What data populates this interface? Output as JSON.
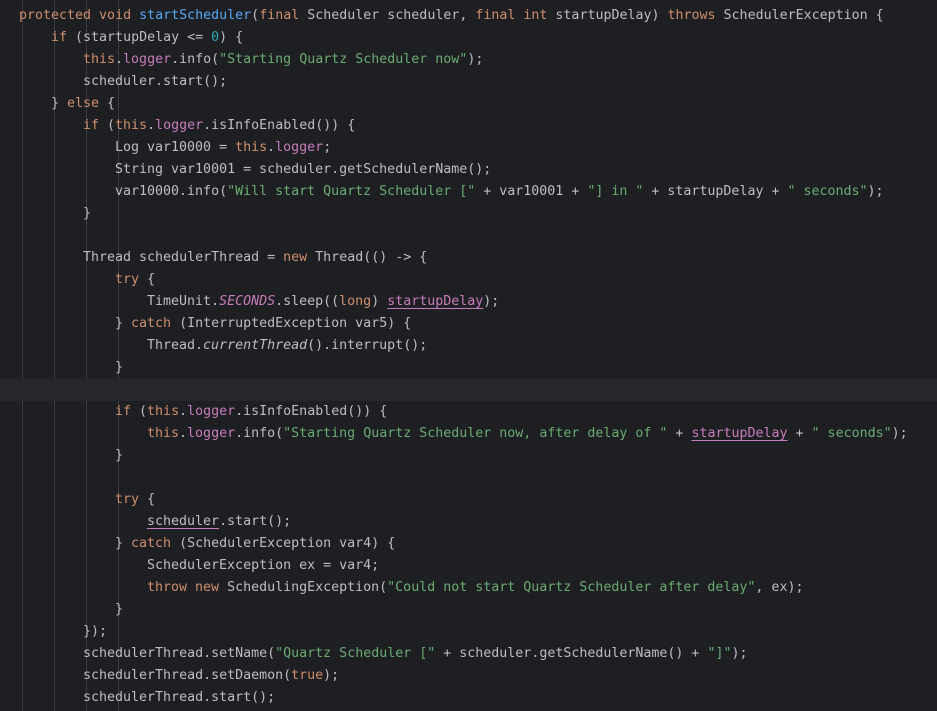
{
  "editor": {
    "language": "java",
    "colors": {
      "background": "#1e1f22",
      "current_line": "#26282e",
      "indent_guide": "#393b40",
      "keyword": "#cf8e6d",
      "function": "#56a8f5",
      "string": "#6aab73",
      "number": "#2aacb8",
      "field": "#c77dbb",
      "plain": "#bcbec4"
    },
    "lines": [
      {
        "indent": 0,
        "tokens": [
          {
            "t": "protected void ",
            "c": "kw"
          },
          {
            "t": "startScheduler",
            "c": "fn"
          },
          {
            "t": "(",
            "c": "pl"
          },
          {
            "t": "final ",
            "c": "kw"
          },
          {
            "t": "Scheduler scheduler, ",
            "c": "pl"
          },
          {
            "t": "final int ",
            "c": "kw"
          },
          {
            "t": "startupDelay) ",
            "c": "pl"
          },
          {
            "t": "throws ",
            "c": "kw"
          },
          {
            "t": "SchedulerException {",
            "c": "pl"
          }
        ]
      },
      {
        "indent": 1,
        "tokens": [
          {
            "t": "if ",
            "c": "kw"
          },
          {
            "t": "(startupDelay <= ",
            "c": "pl"
          },
          {
            "t": "0",
            "c": "num"
          },
          {
            "t": ") {",
            "c": "pl"
          }
        ]
      },
      {
        "indent": 2,
        "tokens": [
          {
            "t": "this",
            "c": "kw"
          },
          {
            "t": ".",
            "c": "pl"
          },
          {
            "t": "logger",
            "c": "fld"
          },
          {
            "t": ".info(",
            "c": "pl"
          },
          {
            "t": "\"Starting Quartz Scheduler now\"",
            "c": "str"
          },
          {
            "t": ");",
            "c": "pl"
          }
        ]
      },
      {
        "indent": 2,
        "tokens": [
          {
            "t": "scheduler.start();",
            "c": "pl"
          }
        ]
      },
      {
        "indent": 1,
        "tokens": [
          {
            "t": "} ",
            "c": "pl"
          },
          {
            "t": "else ",
            "c": "kw"
          },
          {
            "t": "{",
            "c": "pl"
          }
        ]
      },
      {
        "indent": 2,
        "tokens": [
          {
            "t": "if ",
            "c": "kw"
          },
          {
            "t": "(",
            "c": "pl"
          },
          {
            "t": "this",
            "c": "kw"
          },
          {
            "t": ".",
            "c": "pl"
          },
          {
            "t": "logger",
            "c": "fld"
          },
          {
            "t": ".isInfoEnabled()) {",
            "c": "pl"
          }
        ]
      },
      {
        "indent": 3,
        "tokens": [
          {
            "t": "Log var10000 = ",
            "c": "pl"
          },
          {
            "t": "this",
            "c": "kw"
          },
          {
            "t": ".",
            "c": "pl"
          },
          {
            "t": "logger",
            "c": "fld"
          },
          {
            "t": ";",
            "c": "pl"
          }
        ]
      },
      {
        "indent": 3,
        "tokens": [
          {
            "t": "String var10001 = scheduler.getSchedulerName();",
            "c": "pl"
          }
        ]
      },
      {
        "indent": 3,
        "tokens": [
          {
            "t": "var10000.info(",
            "c": "pl"
          },
          {
            "t": "\"Will start Quartz Scheduler [\"",
            "c": "str"
          },
          {
            "t": " + var10001 + ",
            "c": "pl"
          },
          {
            "t": "\"] in \"",
            "c": "str"
          },
          {
            "t": " + startupDelay + ",
            "c": "pl"
          },
          {
            "t": "\" seconds\"",
            "c": "str"
          },
          {
            "t": ");",
            "c": "pl"
          }
        ]
      },
      {
        "indent": 2,
        "tokens": [
          {
            "t": "}",
            "c": "pl"
          }
        ]
      },
      {
        "indent": 0,
        "tokens": []
      },
      {
        "indent": 2,
        "tokens": [
          {
            "t": "Thread schedulerThread = ",
            "c": "pl"
          },
          {
            "t": "new ",
            "c": "kw"
          },
          {
            "t": "Thread(() -> {",
            "c": "pl"
          }
        ]
      },
      {
        "indent": 3,
        "tokens": [
          {
            "t": "try ",
            "c": "kw"
          },
          {
            "t": "{",
            "c": "pl"
          }
        ]
      },
      {
        "indent": 4,
        "tokens": [
          {
            "t": "TimeUnit.",
            "c": "pl"
          },
          {
            "t": "SECONDS",
            "c": "sfld"
          },
          {
            "t": ".sleep((",
            "c": "pl"
          },
          {
            "t": "long",
            "c": "kw"
          },
          {
            "t": ") ",
            "c": "pl"
          },
          {
            "t": "startupDelay",
            "c": "cap"
          },
          {
            "t": ");",
            "c": "pl"
          }
        ]
      },
      {
        "indent": 3,
        "tokens": [
          {
            "t": "} ",
            "c": "pl"
          },
          {
            "t": "catch ",
            "c": "kw"
          },
          {
            "t": "(InterruptedException var5) {",
            "c": "pl"
          }
        ]
      },
      {
        "indent": 4,
        "tokens": [
          {
            "t": "Thread.",
            "c": "pl"
          },
          {
            "t": "currentThread",
            "c": "ital"
          },
          {
            "t": "().interrupt();",
            "c": "pl"
          }
        ]
      },
      {
        "indent": 3,
        "tokens": [
          {
            "t": "}",
            "c": "pl"
          }
        ]
      },
      {
        "indent": 0,
        "current": true,
        "tokens": []
      },
      {
        "indent": 3,
        "tokens": [
          {
            "t": "if ",
            "c": "kw"
          },
          {
            "t": "(",
            "c": "pl"
          },
          {
            "t": "this",
            "c": "kw"
          },
          {
            "t": ".",
            "c": "pl"
          },
          {
            "t": "logger",
            "c": "fld"
          },
          {
            "t": ".isInfoEnabled()) {",
            "c": "pl"
          }
        ]
      },
      {
        "indent": 4,
        "tokens": [
          {
            "t": "this",
            "c": "kw"
          },
          {
            "t": ".",
            "c": "pl"
          },
          {
            "t": "logger",
            "c": "fld"
          },
          {
            "t": ".info(",
            "c": "pl"
          },
          {
            "t": "\"Starting Quartz Scheduler now, after delay of \"",
            "c": "str"
          },
          {
            "t": " + ",
            "c": "pl"
          },
          {
            "t": "startupDelay",
            "c": "cap"
          },
          {
            "t": " + ",
            "c": "pl"
          },
          {
            "t": "\" seconds\"",
            "c": "str"
          },
          {
            "t": ");",
            "c": "pl"
          }
        ]
      },
      {
        "indent": 3,
        "tokens": [
          {
            "t": "}",
            "c": "pl"
          }
        ]
      },
      {
        "indent": 0,
        "tokens": []
      },
      {
        "indent": 3,
        "tokens": [
          {
            "t": "try ",
            "c": "kw"
          },
          {
            "t": "{",
            "c": "pl"
          }
        ]
      },
      {
        "indent": 4,
        "tokens": [
          {
            "t": "scheduler",
            "c": "capv"
          },
          {
            "t": ".start();",
            "c": "pl"
          }
        ]
      },
      {
        "indent": 3,
        "tokens": [
          {
            "t": "} ",
            "c": "pl"
          },
          {
            "t": "catch ",
            "c": "kw"
          },
          {
            "t": "(SchedulerException var4) {",
            "c": "pl"
          }
        ]
      },
      {
        "indent": 4,
        "tokens": [
          {
            "t": "SchedulerException ex = var4;",
            "c": "pl"
          }
        ]
      },
      {
        "indent": 4,
        "tokens": [
          {
            "t": "throw new ",
            "c": "kw"
          },
          {
            "t": "SchedulingException(",
            "c": "pl"
          },
          {
            "t": "\"Could not start Quartz Scheduler after delay\"",
            "c": "str"
          },
          {
            "t": ", ex);",
            "c": "pl"
          }
        ]
      },
      {
        "indent": 3,
        "tokens": [
          {
            "t": "}",
            "c": "pl"
          }
        ]
      },
      {
        "indent": 2,
        "tokens": [
          {
            "t": "});",
            "c": "pl"
          }
        ]
      },
      {
        "indent": 2,
        "tokens": [
          {
            "t": "schedulerThread.setName(",
            "c": "pl"
          },
          {
            "t": "\"Quartz Scheduler [\"",
            "c": "str"
          },
          {
            "t": " + scheduler.getSchedulerName() + ",
            "c": "pl"
          },
          {
            "t": "\"]\"",
            "c": "str"
          },
          {
            "t": ");",
            "c": "pl"
          }
        ]
      },
      {
        "indent": 2,
        "tokens": [
          {
            "t": "schedulerThread.setDaemon(",
            "c": "pl"
          },
          {
            "t": "true",
            "c": "kw"
          },
          {
            "t": ");",
            "c": "pl"
          }
        ]
      },
      {
        "indent": 2,
        "tokens": [
          {
            "t": "schedulerThread.start();",
            "c": "pl"
          }
        ]
      }
    ]
  }
}
